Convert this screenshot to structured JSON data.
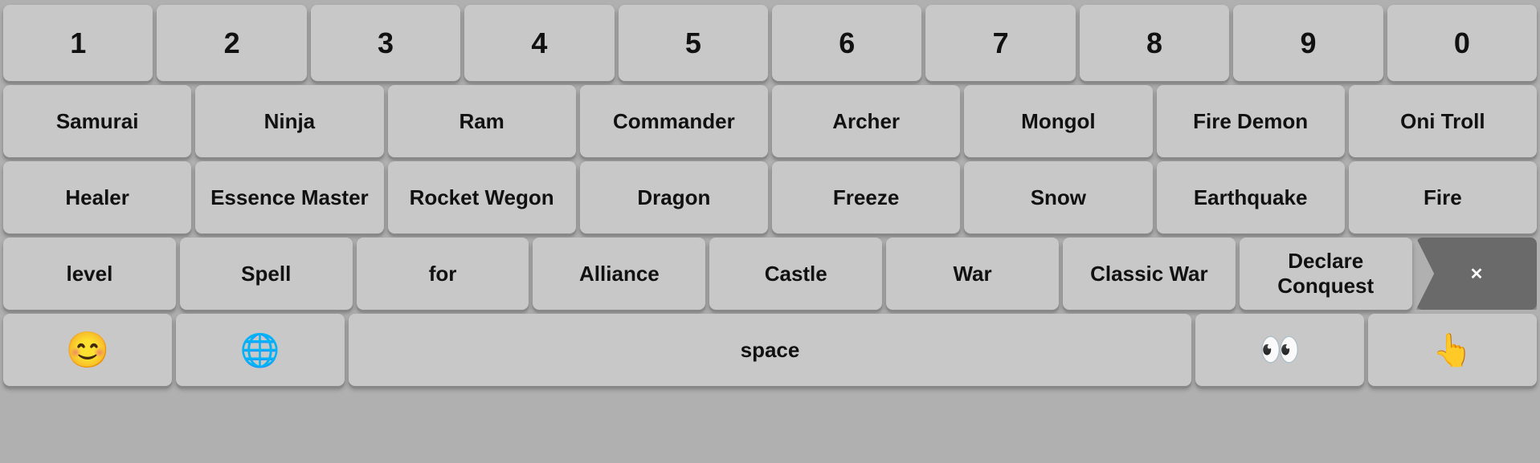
{
  "rows": [
    {
      "id": "row1",
      "keys": [
        {
          "id": "key-1",
          "label": "1"
        },
        {
          "id": "key-2",
          "label": "2"
        },
        {
          "id": "key-3",
          "label": "3"
        },
        {
          "id": "key-4",
          "label": "4"
        },
        {
          "id": "key-5",
          "label": "5"
        },
        {
          "id": "key-6",
          "label": "6"
        },
        {
          "id": "key-7",
          "label": "7"
        },
        {
          "id": "key-8",
          "label": "8"
        },
        {
          "id": "key-9",
          "label": "9"
        },
        {
          "id": "key-0",
          "label": "0"
        }
      ]
    },
    {
      "id": "row2",
      "keys": [
        {
          "id": "key-samurai",
          "label": "Samurai"
        },
        {
          "id": "key-ninja",
          "label": "Ninja"
        },
        {
          "id": "key-ram",
          "label": "Ram"
        },
        {
          "id": "key-commander",
          "label": "Commander"
        },
        {
          "id": "key-archer",
          "label": "Archer"
        },
        {
          "id": "key-mongol",
          "label": "Mongol"
        },
        {
          "id": "key-fire-demon",
          "label": "Fire Demon"
        },
        {
          "id": "key-oni-troll",
          "label": "Oni Troll"
        }
      ]
    },
    {
      "id": "row3",
      "keys": [
        {
          "id": "key-healer",
          "label": "Healer"
        },
        {
          "id": "key-essence-master",
          "label": "Essence Master"
        },
        {
          "id": "key-rocket-wegon",
          "label": "Rocket Wegon"
        },
        {
          "id": "key-dragon",
          "label": "Dragon"
        },
        {
          "id": "key-freeze",
          "label": "Freeze"
        },
        {
          "id": "key-snow",
          "label": "Snow"
        },
        {
          "id": "key-earthquake",
          "label": "Earthquake"
        },
        {
          "id": "key-fire",
          "label": "Fire"
        }
      ]
    },
    {
      "id": "row4",
      "keys": [
        {
          "id": "key-level",
          "label": "level"
        },
        {
          "id": "key-spell",
          "label": "Spell"
        },
        {
          "id": "key-for",
          "label": "for"
        },
        {
          "id": "key-alliance",
          "label": "Alliance"
        },
        {
          "id": "key-castle",
          "label": "Castle"
        },
        {
          "id": "key-war",
          "label": "War"
        },
        {
          "id": "key-classic-war",
          "label": "Classic War"
        },
        {
          "id": "key-declare-conquest",
          "label": "Declare Conquest"
        },
        {
          "id": "key-backspace",
          "label": "⌫",
          "special": "backspace"
        }
      ]
    },
    {
      "id": "row5",
      "keys": [
        {
          "id": "key-emoji",
          "label": "😊",
          "special": "emoji"
        },
        {
          "id": "key-globe",
          "label": "🌐",
          "special": "globe"
        },
        {
          "id": "key-space",
          "label": "space",
          "special": "space"
        },
        {
          "id": "key-face2",
          "label": "👀",
          "special": "face2"
        },
        {
          "id": "key-hand",
          "label": "👆",
          "special": "hand"
        }
      ]
    }
  ]
}
